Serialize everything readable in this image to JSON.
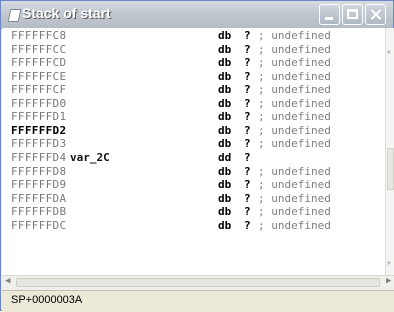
{
  "window": {
    "title": "Stack of start"
  },
  "rows": [
    {
      "addr": "FFFFFFC8",
      "var": "",
      "dir": "db",
      "q": "?",
      "cmt": "; undefined",
      "bold": false
    },
    {
      "addr": "FFFFFFCC",
      "var": "",
      "dir": "db",
      "q": "?",
      "cmt": "; undefined",
      "bold": false
    },
    {
      "addr": "FFFFFFCD",
      "var": "",
      "dir": "db",
      "q": "?",
      "cmt": "; undefined",
      "bold": false
    },
    {
      "addr": "FFFFFFCE",
      "var": "",
      "dir": "db",
      "q": "?",
      "cmt": "; undefined",
      "bold": false
    },
    {
      "addr": "FFFFFFCF",
      "var": "",
      "dir": "db",
      "q": "?",
      "cmt": "; undefined",
      "bold": false
    },
    {
      "addr": "FFFFFFD0",
      "var": "",
      "dir": "db",
      "q": "?",
      "cmt": "; undefined",
      "bold": false
    },
    {
      "addr": "FFFFFFD1",
      "var": "",
      "dir": "db",
      "q": "?",
      "cmt": "; undefined",
      "bold": false
    },
    {
      "addr": "FFFFFFD2",
      "var": "",
      "dir": "db",
      "q": "?",
      "cmt": "; undefined",
      "bold": true
    },
    {
      "addr": "FFFFFFD3",
      "var": "",
      "dir": "db",
      "q": "?",
      "cmt": "; undefined",
      "bold": false
    },
    {
      "addr": "FFFFFFD4",
      "var": "var_2C",
      "dir": "dd",
      "q": "?",
      "cmt": "",
      "bold": false
    },
    {
      "addr": "FFFFFFD8",
      "var": "",
      "dir": "db",
      "q": "?",
      "cmt": "; undefined",
      "bold": false
    },
    {
      "addr": "FFFFFFD9",
      "var": "",
      "dir": "db",
      "q": "?",
      "cmt": "; undefined",
      "bold": false
    },
    {
      "addr": "FFFFFFDA",
      "var": "",
      "dir": "db",
      "q": "?",
      "cmt": "; undefined",
      "bold": false
    },
    {
      "addr": "FFFFFFDB",
      "var": "",
      "dir": "db",
      "q": "?",
      "cmt": "; undefined",
      "bold": false
    },
    {
      "addr": "FFFFFFDC",
      "var": "",
      "dir": "db",
      "q": "?",
      "cmt": "; undefined",
      "bold": false
    }
  ],
  "status": {
    "text": "SP+0000003A"
  },
  "icons": {
    "title": "stack-window-icon",
    "minimize": "minimize-icon",
    "maximize": "maximize-icon",
    "close": "close-icon",
    "scroll_left": "scroll-left-arrow-icon",
    "scroll_right": "scroll-right-arrow-icon"
  }
}
